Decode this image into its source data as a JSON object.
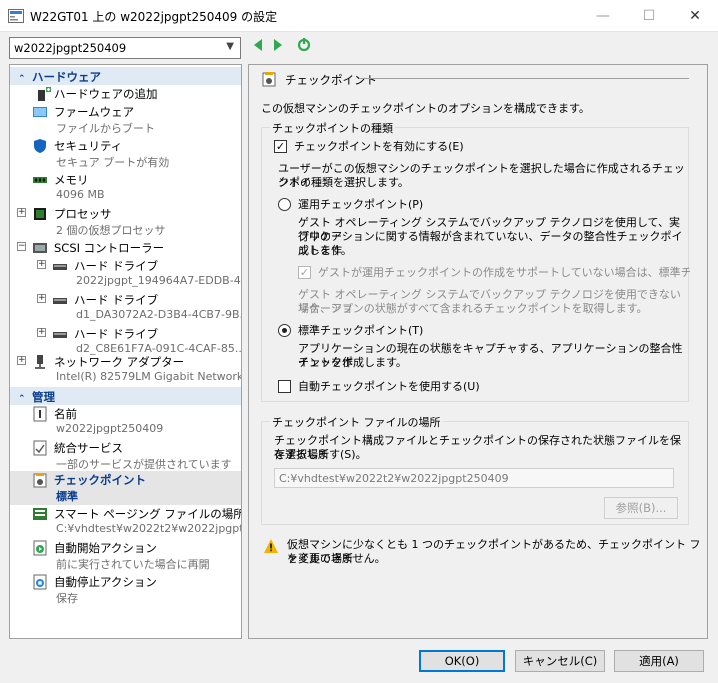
{
  "window": {
    "title": "W22GT01 上の w2022jpgpt250409 の設定",
    "icons": {
      "app": "settings-app-icon",
      "minimize": "minimize-icon",
      "maximize": "maximize-icon",
      "close": "close-icon"
    }
  },
  "vm_selector": {
    "value": "w2022jpgpt250409"
  },
  "nav": {
    "icons": [
      "back-icon",
      "forward-icon",
      "refresh-icon"
    ]
  },
  "sidebar": {
    "hardware_header": "ハードウェア",
    "management_header": "管理",
    "hardware_items": [
      {
        "label": "ハードウェアの追加",
        "sub": ""
      },
      {
        "label": "ファームウェア",
        "sub": "ファイルからブート"
      },
      {
        "label": "セキュリティ",
        "sub": "セキュア ブートが有効"
      },
      {
        "label": "メモリ",
        "sub": "4096 MB"
      },
      {
        "label": "プロセッサ",
        "sub": "2 個の仮想プロセッサ"
      },
      {
        "label": "SCSI コントローラー",
        "sub": ""
      },
      {
        "label": "ハード ドライブ",
        "sub": "2022jpgpt_194964A7-EDDB-4..."
      },
      {
        "label": "ハード ドライブ",
        "sub": "d1_DA3072A2-D3B4-4CB7-9B..."
      },
      {
        "label": "ハード ドライブ",
        "sub": "d2_C8E61F7A-091C-4CAF-85..."
      },
      {
        "label": "ネットワーク アダプター",
        "sub": "Intel(R) 82579LM Gigabit Network ..."
      }
    ],
    "management_items": [
      {
        "label": "名前",
        "sub": "w2022jpgpt250409"
      },
      {
        "label": "統合サービス",
        "sub": "一部のサービスが提供されています"
      },
      {
        "label": "チェックポイント",
        "sub": "標準"
      },
      {
        "label": "スマート ページング ファイルの場所",
        "sub": "C:¥vhdtest¥w2022t2¥w2022jpgpt..."
      },
      {
        "label": "自動開始アクション",
        "sub": "前に実行されていた場合に再開"
      },
      {
        "label": "自動停止アクション",
        "sub": "保存"
      }
    ]
  },
  "panel": {
    "title": "チェックポイント",
    "description": "この仮想マシンのチェックポイントのオプションを構成できます。",
    "type_group": {
      "title": "チェックポイントの種類",
      "enable_label": "チェックポイントを有効にする(E)",
      "enable_checked": true,
      "select_text_1": "ユーザーがこの仮想マシンのチェックポイントを選択した場合に作成されるチェックポイ",
      "select_text_2": "ントの種類を選択します。",
      "production_label": "運用チェックポイント(P)",
      "production_desc_1": "ゲスト オペレーティング システムでバックアップ テクノロジを使用して、実行中のア",
      "production_desc_2": "プリケーションに関する情報が含まれていない、データの整合性チェックポイントを作",
      "production_desc_3": "成します。",
      "fallback_label": "ゲストが運用チェックポイントの作成をサポートしていない場合は、標準チェックポイ",
      "fallback_checked": true,
      "fallback_desc_1": "ゲスト オペレーティング システムでバックアップ テクノロジを使用できない場合、アプ",
      "fallback_desc_2": "リケーションの状態がすべて含まれるチェックポイントを取得します。",
      "standard_label": "標準チェックポイント(T)",
      "standard_desc_1": "アプリケーションの現在の状態をキャプチャする、アプリケーションの整合性チェックポ",
      "standard_desc_2": "イントを作成します。",
      "selected_type": "standard",
      "auto_label": "自動チェックポイントを使用する(U)",
      "auto_checked": false
    },
    "location_group": {
      "title": "チェックポイント ファイルの場所",
      "desc_1": "チェックポイント構成ファイルとチェックポイントの保存された状態ファイルを保存する場所",
      "desc_2": "を選択します(S)。",
      "path": "C:¥vhdtest¥w2022t2¥w2022jpgpt250409",
      "browse_label": "参照(B)..."
    },
    "warning_1": "仮想マシンに少なくとも 1 つのチェックポイントがあるため、チェックポイント ファイルの場所",
    "warning_2": "を変更できません。"
  },
  "footer": {
    "ok_label": "OK(O)",
    "cancel_label": "キャンセル(C)",
    "apply_label": "適用(A)"
  },
  "colors": {
    "accent": "#0078d7",
    "section_header_bg": "#dfeaf5",
    "section_header_text": "#0b3d8c"
  }
}
